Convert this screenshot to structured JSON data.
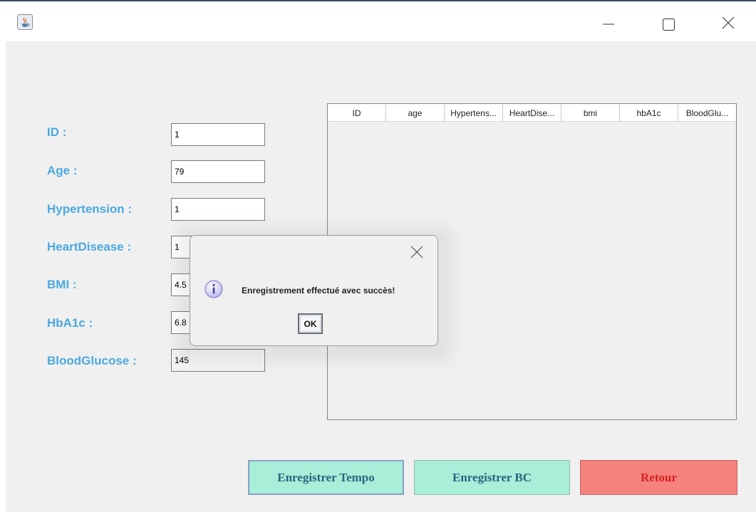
{
  "window": {
    "icon": "java-coffee-icon",
    "controls": [
      "minimize-icon",
      "maximize-icon",
      "close-icon"
    ]
  },
  "form": {
    "fields": [
      {
        "label": "ID :",
        "value": "1"
      },
      {
        "label": "Age :",
        "value": "79"
      },
      {
        "label": "Hypertension :",
        "value": "1"
      },
      {
        "label": "HeartDisease :",
        "value": "1"
      },
      {
        "label": "BMI :",
        "value": "4.5"
      },
      {
        "label": "HbA1c :",
        "value": "6.8"
      },
      {
        "label": "BloodGlucose :",
        "value": "145"
      }
    ]
  },
  "table": {
    "columns": [
      "ID",
      "age",
      "Hypertens...",
      "HeartDise...",
      "bmi",
      "hbA1c",
      "BloodGlu..."
    ],
    "rows": []
  },
  "buttons": {
    "save_tempo": "Enregistrer Tempo",
    "save_bc": "Enregistrer BC",
    "back": "Retour"
  },
  "dialog": {
    "icon": "info-icon",
    "message": "Enregistrement effectué avec succès!",
    "ok_label": "OK"
  },
  "colors": {
    "label": "#4aa9e0",
    "save_button_bg": "#a8eed8",
    "back_button_bg": "#f5827c",
    "back_button_text": "#d92020"
  }
}
